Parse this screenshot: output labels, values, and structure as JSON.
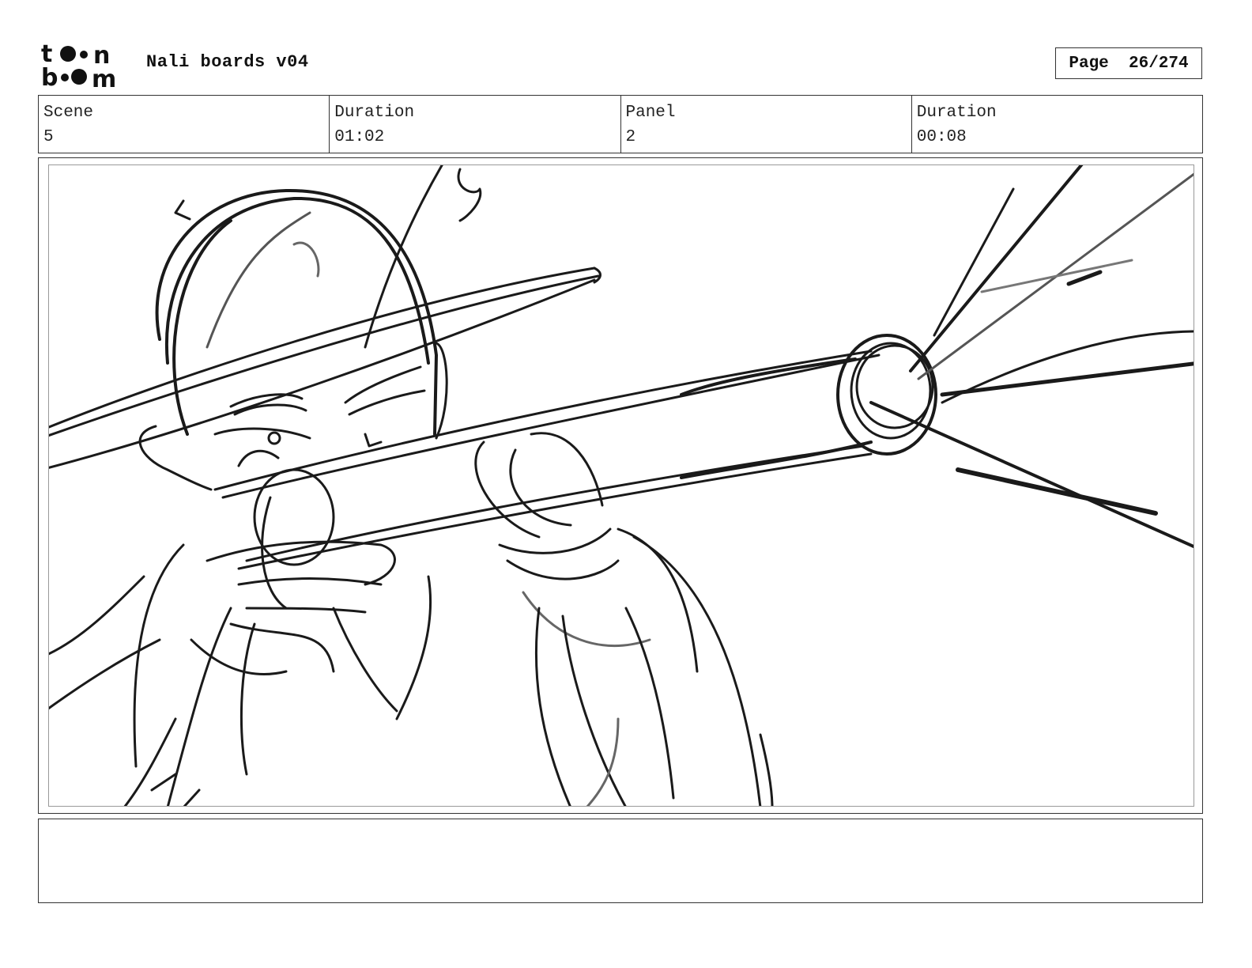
{
  "header": {
    "logo_top": "t••n",
    "logo_bottom": "b••m",
    "title": "Nali boards v04",
    "page_label": "Page",
    "page_value": "26/274"
  },
  "info": [
    {
      "label": "Scene",
      "value": "5"
    },
    {
      "label": "Duration",
      "value": "01:02"
    },
    {
      "label": "Panel",
      "value": "2"
    },
    {
      "label": "Duration",
      "value": "00:08"
    }
  ],
  "panel": {
    "illustration": "rough-sketch-character-aiming-tube"
  },
  "notes": {
    "text": ""
  }
}
